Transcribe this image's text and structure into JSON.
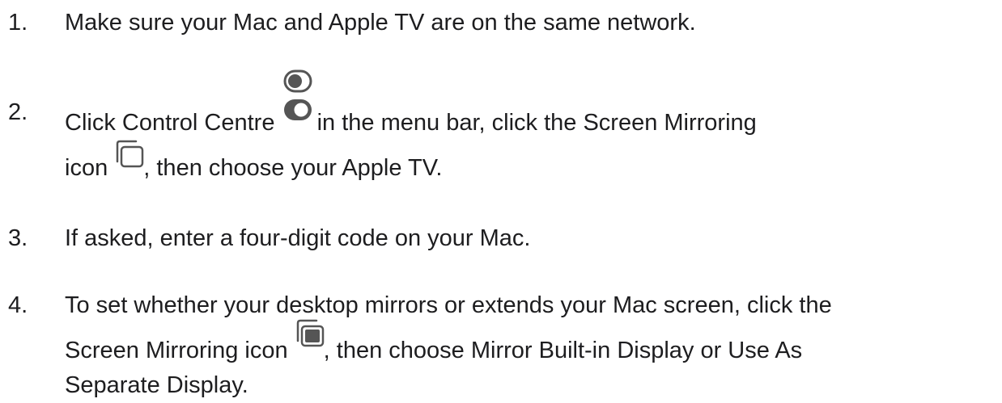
{
  "steps": [
    {
      "number": "1.",
      "text": "Make sure your Mac and Apple TV are on the same network."
    },
    {
      "number": "2.",
      "part_a": "Click Control Centre",
      "part_b": "in the menu bar, click the Screen Mirroring",
      "part_c": "icon",
      "part_d": ", then choose your Apple TV."
    },
    {
      "number": "3.",
      "text": "If asked, enter a four-digit code on your Mac."
    },
    {
      "number": "4.",
      "part_a": "To set whether your desktop mirrors or extends your Mac screen, click the",
      "part_b": "Screen Mirroring icon",
      "part_c": ", then choose Mirror Built-in Display or Use As",
      "part_d": "Separate Display."
    }
  ],
  "icons": {
    "control_centre": "control-centre-toggles-icon",
    "screen_mirroring_outline": "screen-mirroring-outline-icon",
    "screen_mirroring_filled": "screen-mirroring-filled-icon"
  }
}
